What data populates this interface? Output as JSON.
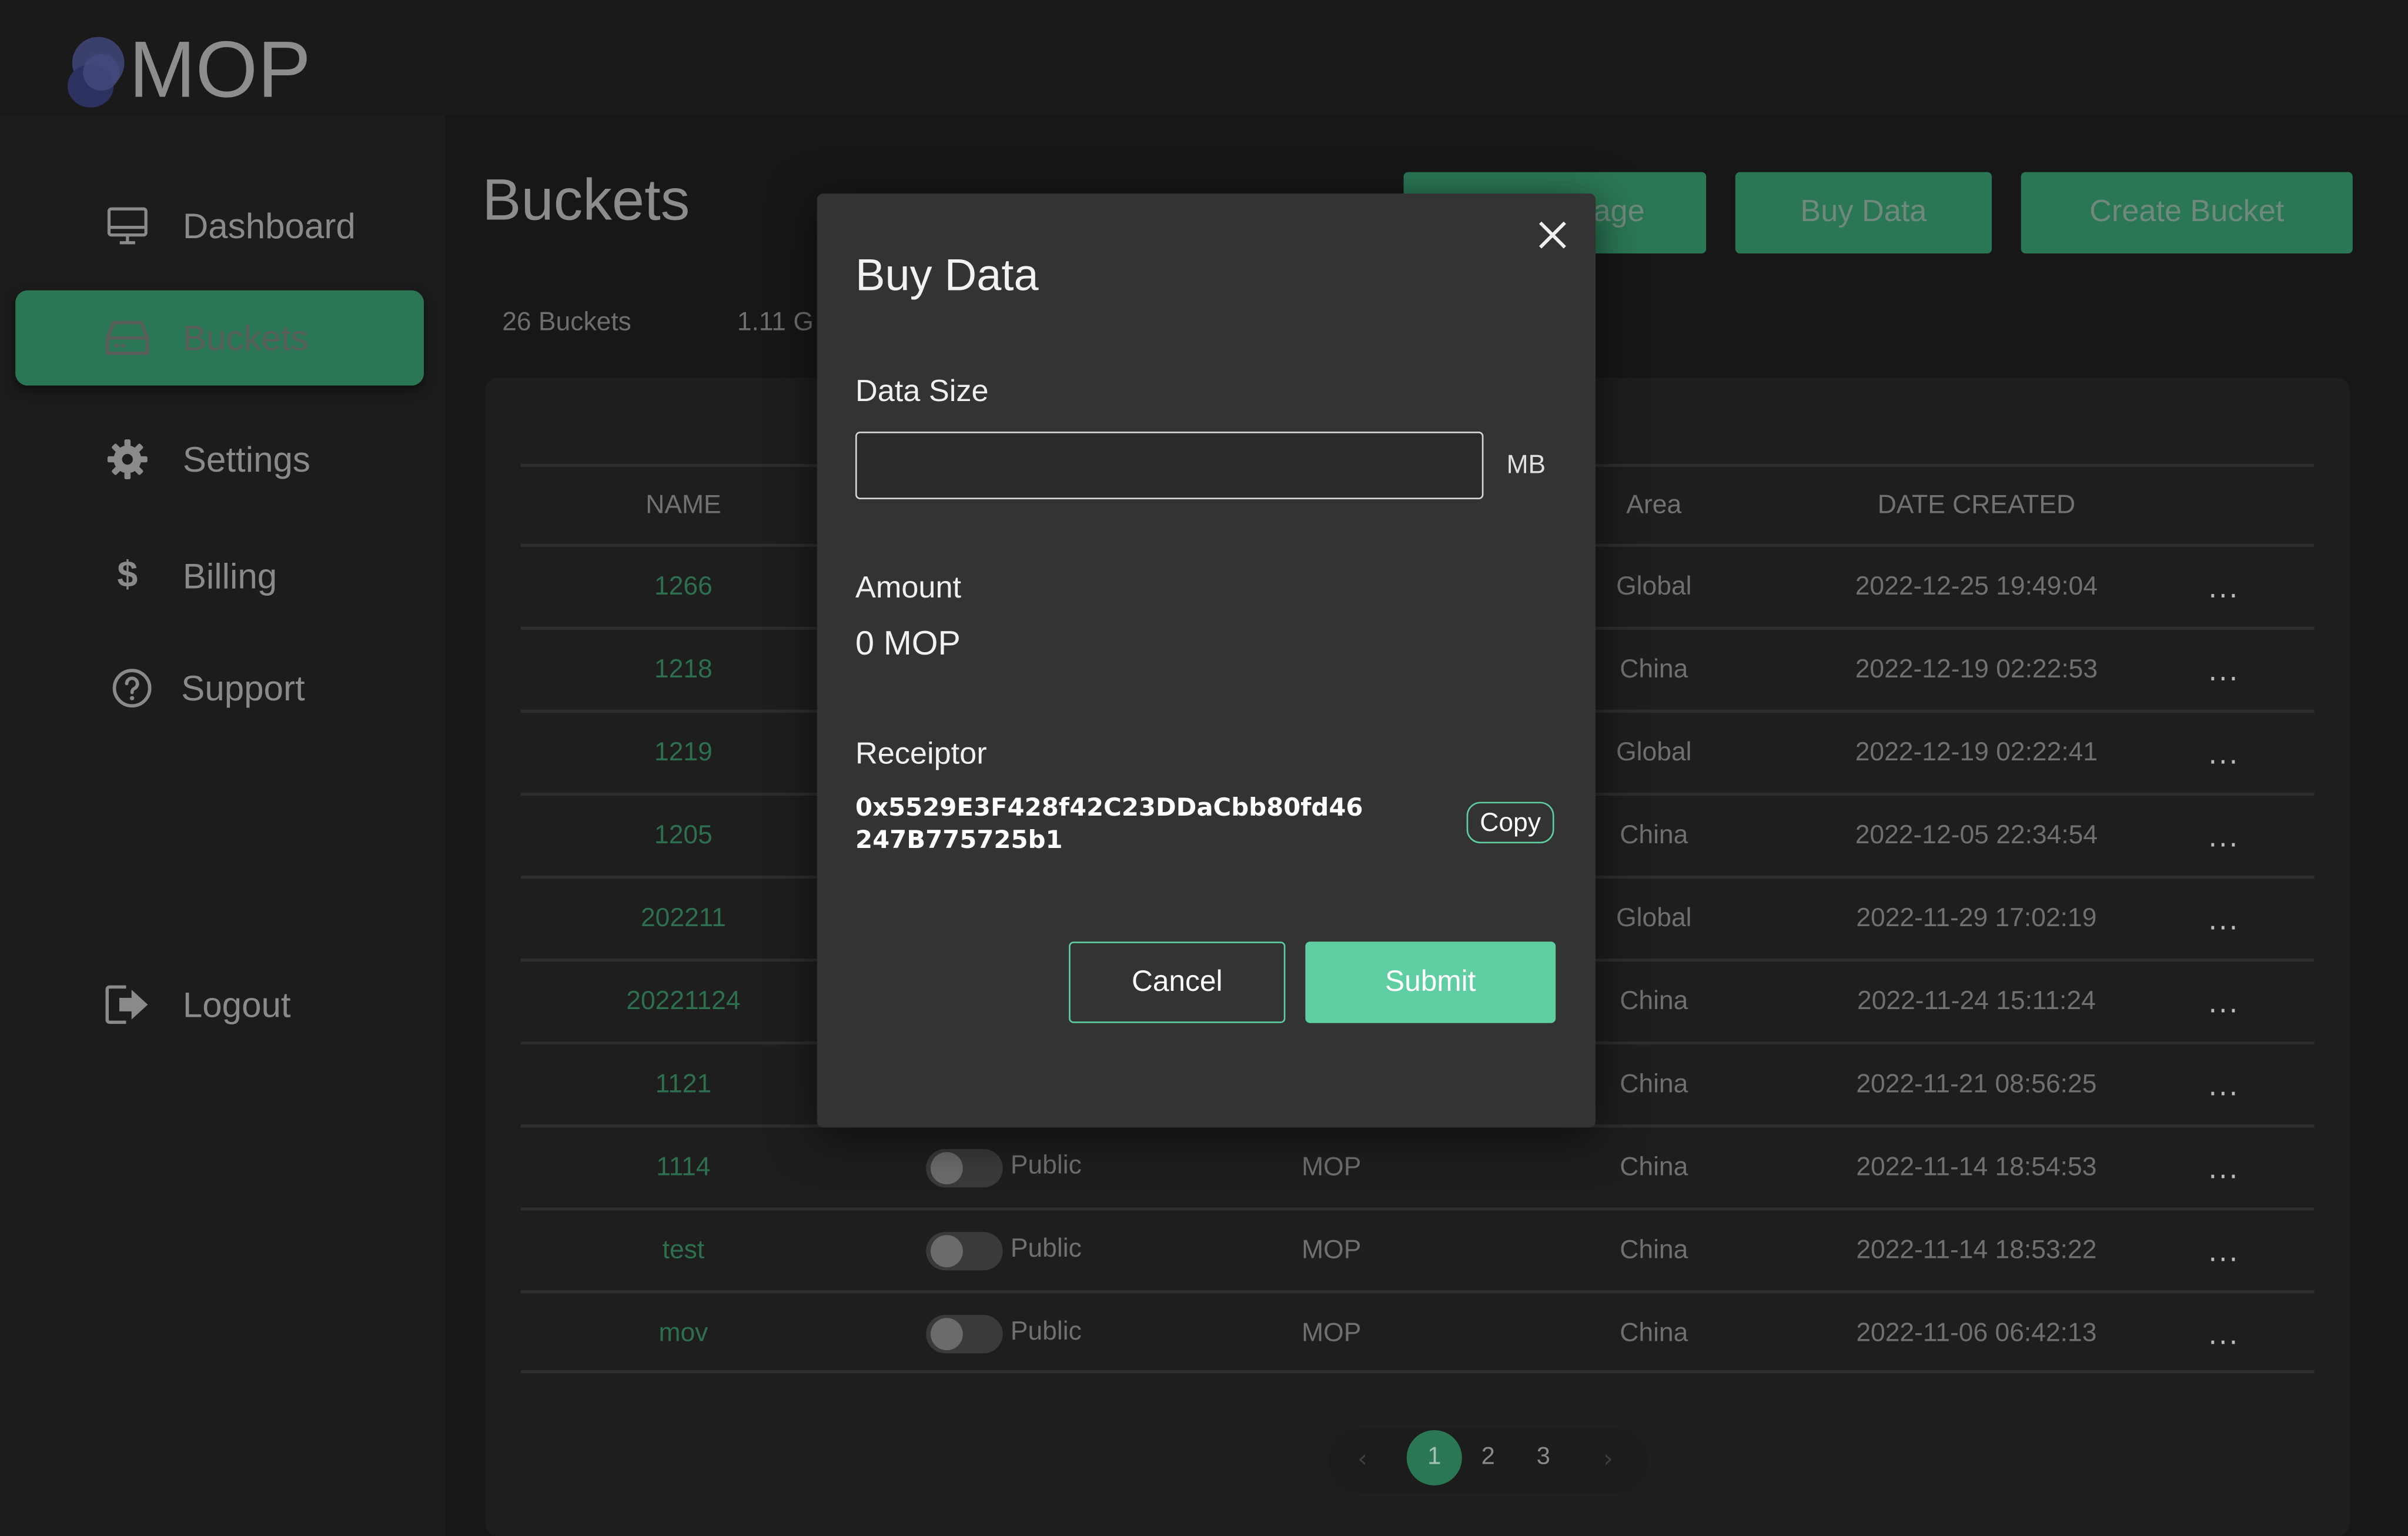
{
  "app": {
    "logo_text": "MOP"
  },
  "sidebar": {
    "items": [
      {
        "label": "Dashboard",
        "icon": "monitor-icon"
      },
      {
        "label": "Buckets",
        "icon": "drive-icon",
        "active": true
      },
      {
        "label": "Settings",
        "icon": "gear-icon"
      },
      {
        "label": "Billing",
        "icon": "dollar-icon"
      },
      {
        "label": "Support",
        "icon": "help-circle-icon"
      }
    ],
    "logout": {
      "label": "Logout",
      "icon": "logout-icon"
    }
  },
  "header": {
    "title": "Buckets",
    "buttons": {
      "hidden_label": "age",
      "buy_data": "Buy Data",
      "create_bucket": "Create Bucket"
    }
  },
  "stats": {
    "buckets": "26 Buckets",
    "size": "1.11 G"
  },
  "table": {
    "columns": {
      "name": "NAME",
      "area": "Area",
      "date": "DATE CREATED"
    },
    "rows": [
      {
        "name": "1266",
        "area": "Global",
        "date": "2022-12-25 19:49:04"
      },
      {
        "name": "1218",
        "area": "China",
        "date": "2022-12-19 02:22:53"
      },
      {
        "name": "1219",
        "area": "Global",
        "date": "2022-12-19 02:22:41"
      },
      {
        "name": "1205",
        "area": "China",
        "date": "2022-12-05 22:34:54"
      },
      {
        "name": "202211",
        "area": "Global",
        "date": "2022-11-29 17:02:19"
      },
      {
        "name": "20221124",
        "area": "China",
        "date": "2022-11-24 15:11:24"
      },
      {
        "name": "1121",
        "area": "China",
        "date": "2022-11-21 08:56:25"
      },
      {
        "name": "1114",
        "access": "Public",
        "provider": "MOP",
        "area": "China",
        "date": "2022-11-14 18:54:53"
      },
      {
        "name": "test",
        "access": "Public",
        "provider": "MOP",
        "area": "China",
        "date": "2022-11-14 18:53:22"
      },
      {
        "name": "mov",
        "access": "Public",
        "provider": "MOP",
        "area": "China",
        "date": "2022-11-06 06:42:13"
      }
    ],
    "row_menu": "..."
  },
  "pagination": {
    "pages": [
      "1",
      "2",
      "3"
    ],
    "current": "1",
    "prev": "‹",
    "next": "›"
  },
  "modal": {
    "title": "Buy Data",
    "data_size_label": "Data Size",
    "data_size_value": "",
    "unit": "MB",
    "amount_label": "Amount",
    "amount_value": "0 MOP",
    "receiptor_label": "Receiptor",
    "receiptor_address": "0x5529E3F428f42C23DDaCbb80fd46247B775725b1",
    "copy_label": "Copy",
    "cancel_label": "Cancel",
    "submit_label": "Submit"
  },
  "colors": {
    "accent": "#2b7755",
    "modal_accent": "#5fcea0",
    "background": "#171717"
  }
}
